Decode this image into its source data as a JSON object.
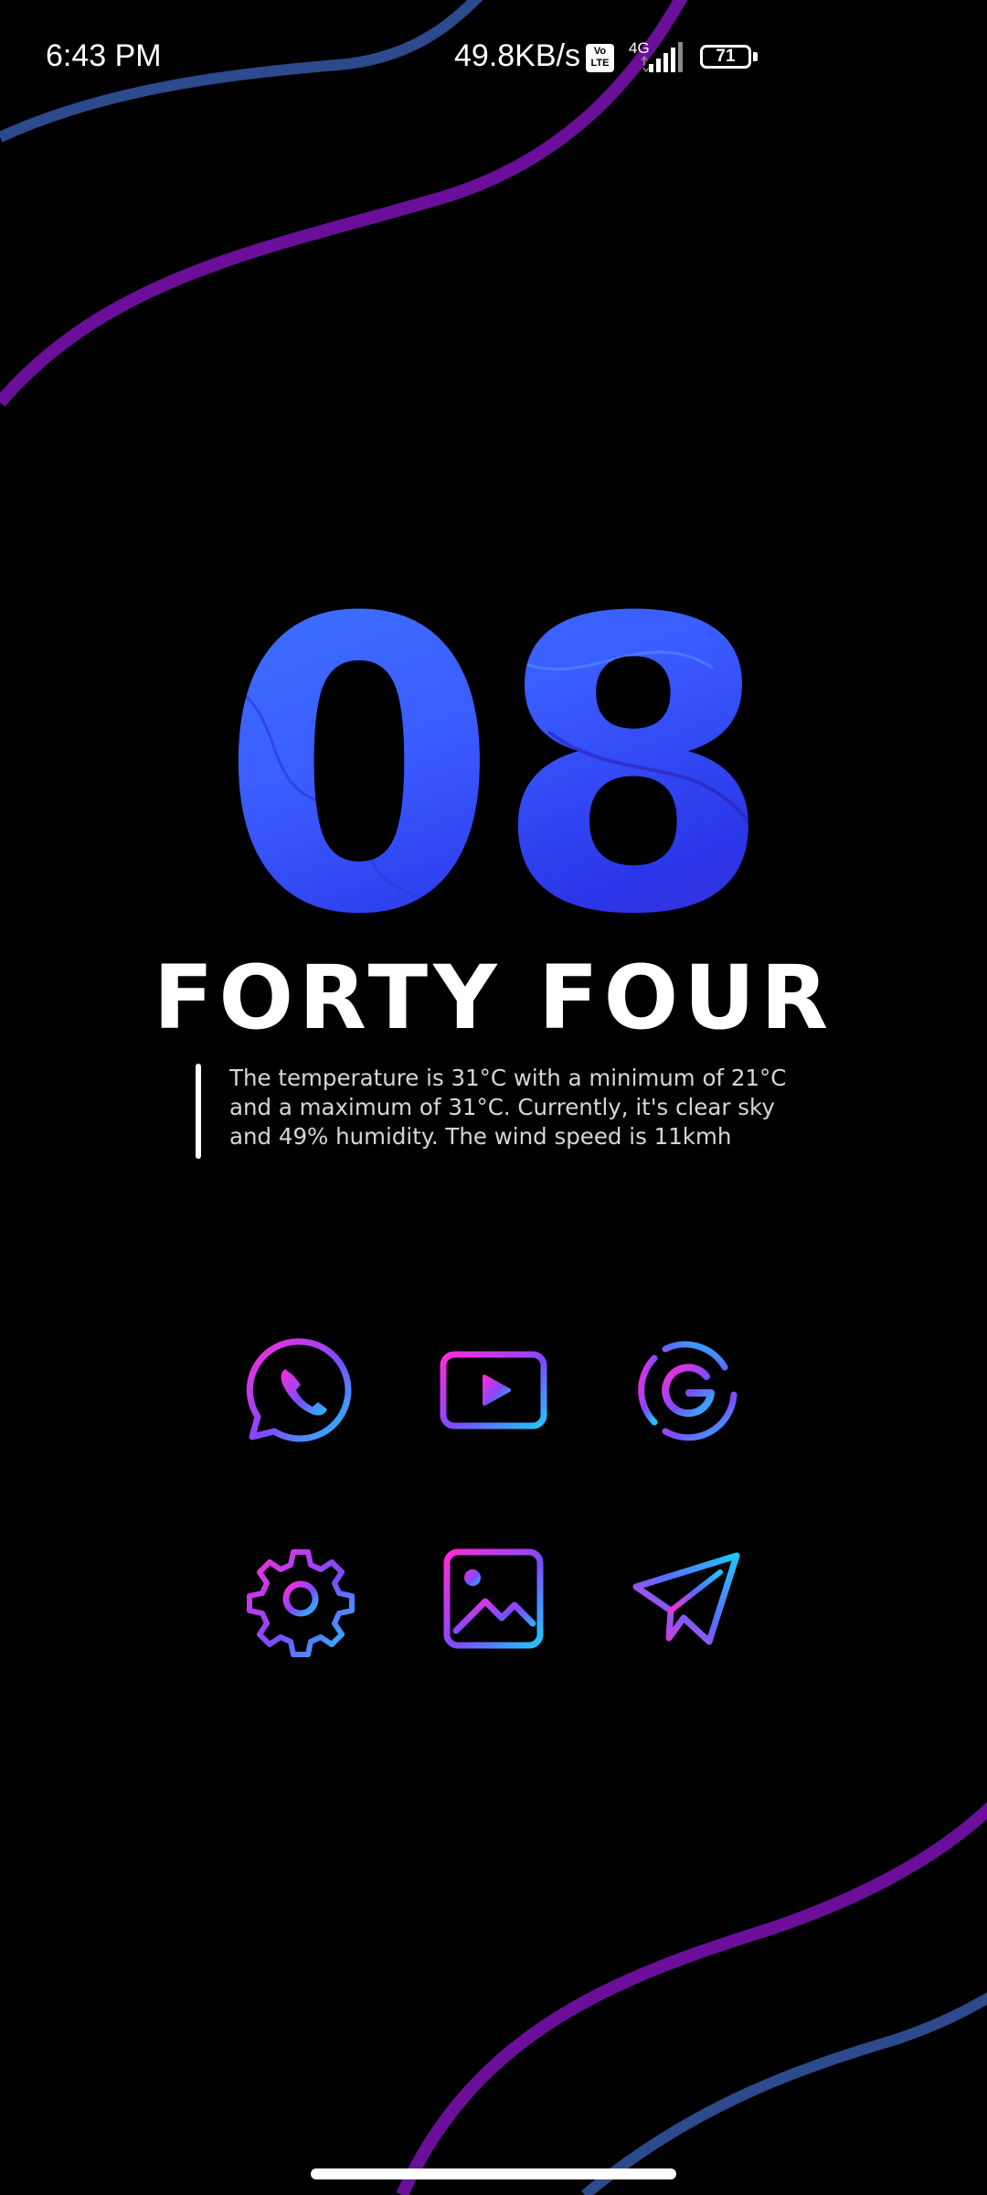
{
  "status_bar": {
    "time": "6:43 PM",
    "network_speed": "49.8KB/s",
    "volte_label_top": "Vo",
    "volte_label_bottom": "LTE",
    "network_type": "4G",
    "battery_level": "71"
  },
  "clock_widget": {
    "hour": "08",
    "minutes_words": "FORTY FOUR",
    "weather_text": "The temperature is 31°C with a minimum of 21°C and a maximum of 31°C. Currently, it's clear sky and 49% humidity. The wind speed is 11kmh"
  },
  "apps": [
    {
      "icon": "whatsapp-icon"
    },
    {
      "icon": "youtube-icon"
    },
    {
      "icon": "google-icon"
    },
    {
      "icon": "settings-icon"
    },
    {
      "icon": "gallery-icon"
    },
    {
      "icon": "telegram-icon"
    }
  ],
  "colors": {
    "background": "#000000",
    "wave_purple": "#6b0f9a",
    "wave_blue": "#2c4a8c",
    "icon_gradient_start": "#ff2bd6",
    "icon_gradient_end": "#1ec8ff",
    "clock_blue": "#3a5cff"
  }
}
